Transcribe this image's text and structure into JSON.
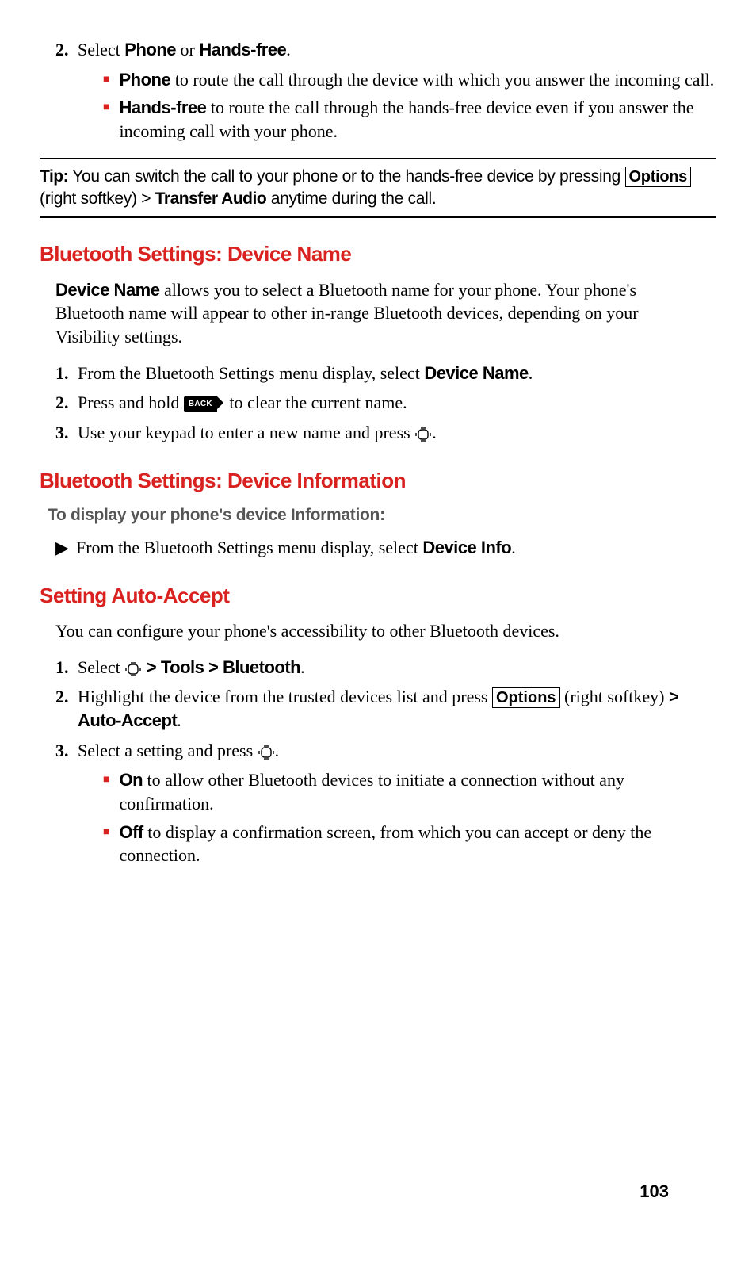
{
  "step2": {
    "num": "2.",
    "pre": "Select ",
    "b1": "Phone",
    "mid": " or ",
    "b2": "Hands-free",
    "post": "."
  },
  "bullets1": {
    "i0": {
      "b": "Phone",
      "t": " to route the call through the device with which you answer the incoming call."
    },
    "i1": {
      "b": "Hands-free",
      "t": " to route the call through the hands-free device even if you answer the incoming call with your phone."
    }
  },
  "tip": {
    "label": "Tip:",
    "t1": " You can switch the call to your phone or to the hands-free device by pressing ",
    "key": "Options",
    "t2": " (right softkey) > ",
    "b": "Transfer Audio",
    "t3": " anytime during the call."
  },
  "h1": "Bluetooth Settings: Device Name",
  "p1": {
    "b": "Device Name",
    "t": " allows you to select a Bluetooth name for your phone. Your phone's Bluetooth name will appear to other in-range Bluetooth devices, depending on your Visibility settings."
  },
  "s1": {
    "num": "1.",
    "t1": "From the Bluetooth Settings menu display, select ",
    "b": "Device Name",
    "t2": "."
  },
  "s2": {
    "num": "2.",
    "t1": "Press and hold ",
    "back": "BACK",
    "t2": " to clear the current name."
  },
  "s3": {
    "num": "3.",
    "t1": "Use your keypad to enter a new name and press ",
    "t2": "."
  },
  "h2": "Bluetooth Settings: Device Information",
  "sub1": "To display your phone's device Information:",
  "a1": {
    "t1": "From the Bluetooth Settings menu display, select ",
    "b": "Device Info",
    "t2": "."
  },
  "h3": "Setting Auto-Accept",
  "p2": "You can configure your phone's accessibility to other Bluetooth devices.",
  "aa1": {
    "num": "1.",
    "t1": "Select ",
    "b": " > Tools > Bluetooth",
    "t2": "."
  },
  "aa2": {
    "num": "2.",
    "t1": "Highlight the device from the trusted devices list and press ",
    "key": "Options",
    "t2": " (right softkey) ",
    "b": "> Auto-Accept",
    "t3": "."
  },
  "aa3": {
    "num": "3.",
    "t1": "Select a setting and press ",
    "t2": "."
  },
  "bullets2": {
    "i0": {
      "b": "On",
      "t": " to allow other Bluetooth devices to initiate a connection without any confirmation."
    },
    "i1": {
      "b": "Off",
      "t": " to display a confirmation screen, from which you can accept or deny the connection."
    }
  },
  "page": "103"
}
